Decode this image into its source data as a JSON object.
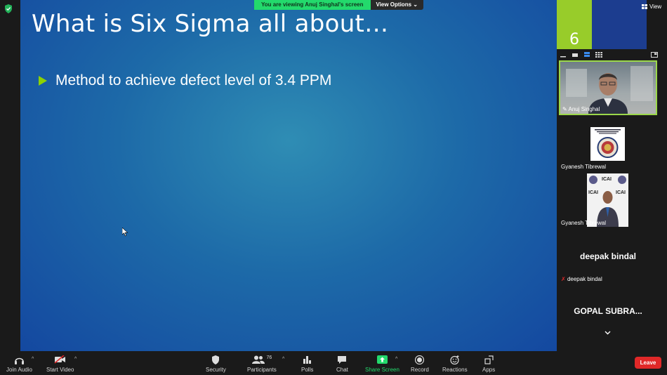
{
  "slide": {
    "title": "What is Six Sigma all about…",
    "bullets": [
      "Method to achieve defect level of 3.4  PPM"
    ]
  },
  "share_banner": {
    "text": "You are viewing Anuj Singhal's screen",
    "view_options": "View Options"
  },
  "right_panel": {
    "slide_number": "6",
    "view_label": "View"
  },
  "participants_tiles": [
    {
      "name": "Anuj Singhal",
      "pinned": true
    },
    {
      "name": "Gyanesh Tibrewal"
    },
    {
      "name": "Gyanesh Tibrewal",
      "badge_text": [
        "ICAI",
        "ICAI",
        "ICAI"
      ]
    },
    {
      "name": "deepak bindal",
      "display": "deepak bindal",
      "muted": true
    },
    {
      "name": "Gopal Subramanian",
      "display": "GOPAL SUBRA..."
    }
  ],
  "toolbar": {
    "join_audio": "Join Audio",
    "start_video": "Start Video",
    "security": "Security",
    "participants": "Participants",
    "participant_count": "76",
    "polls": "Polls",
    "chat": "Chat",
    "share_screen": "Share Screen",
    "record": "Record",
    "reactions": "Reactions",
    "apps": "Apps",
    "leave": "Leave"
  },
  "colors": {
    "accent_green": "#23d96c",
    "leave_red": "#e02828",
    "active_speaker": "#9bd84a"
  }
}
